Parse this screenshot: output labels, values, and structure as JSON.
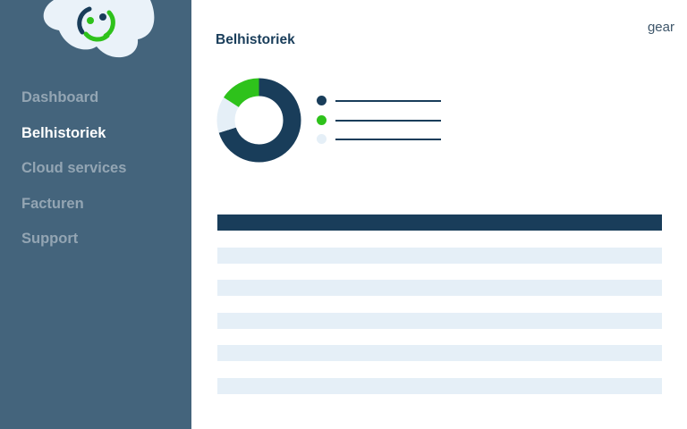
{
  "colors": {
    "sidebar_bg": "#44647c",
    "accent_navy": "#193d5a",
    "accent_green": "#2ec21b",
    "light_blue": "#e5eff7",
    "nav_inactive": "#93a5b3"
  },
  "logo": {
    "icon": "cloud-logo-icon"
  },
  "sidebar": {
    "items": [
      {
        "label": "Dashboard",
        "active": false
      },
      {
        "label": "Belhistoriek",
        "active": true
      },
      {
        "label": "Cloud services",
        "active": false
      },
      {
        "label": "Facturen",
        "active": false
      },
      {
        "label": "Support",
        "active": false
      }
    ]
  },
  "header": {
    "title": "Belhistoriek",
    "gear_label": "gear"
  },
  "chart_data": {
    "type": "pie",
    "donut": true,
    "slices": [
      {
        "value": 70,
        "color": "#193d5a"
      },
      {
        "value": 16,
        "color": "#2ec21b"
      },
      {
        "value": 14,
        "color": "#e5eff7"
      }
    ]
  },
  "table": {
    "row_count": 5
  }
}
